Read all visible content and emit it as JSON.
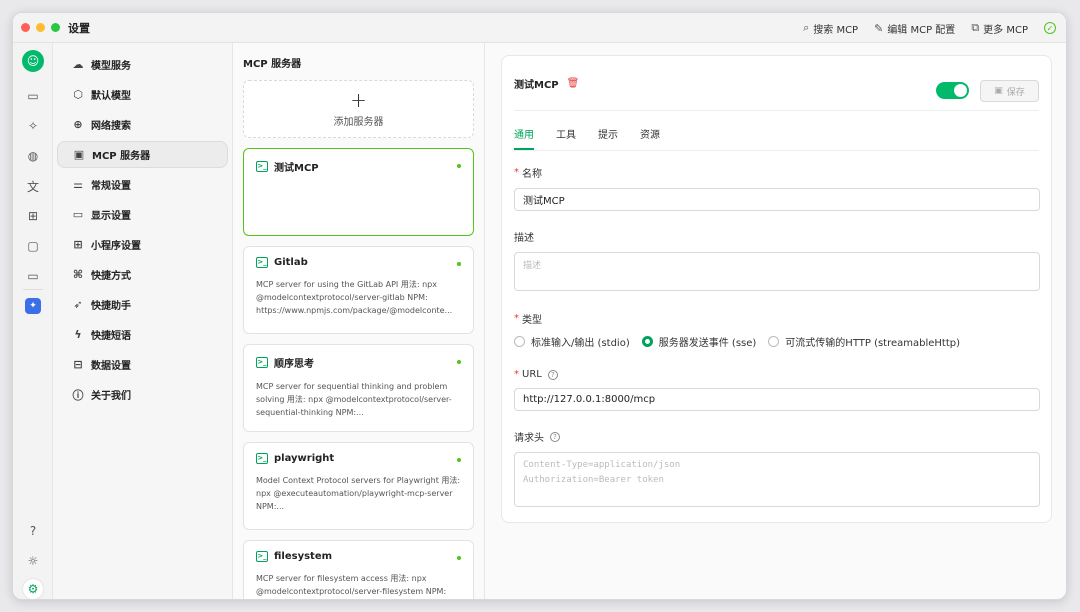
{
  "window": {
    "title": "设置"
  },
  "toolbar": {
    "search_mcp": "搜索 MCP",
    "edit_mcp_config": "编辑 MCP 配置",
    "more_mcp": "更多 MCP"
  },
  "settings_nav": [
    {
      "label": "模型服务",
      "icon": "cloud-icon"
    },
    {
      "label": "默认模型",
      "icon": "cube-icon"
    },
    {
      "label": "网络搜索",
      "icon": "globe-icon"
    },
    {
      "label": "MCP 服务器",
      "icon": "terminal-icon"
    },
    {
      "label": "常规设置",
      "icon": "sliders-icon"
    },
    {
      "label": "显示设置",
      "icon": "monitor-icon"
    },
    {
      "label": "小程序设置",
      "icon": "grid-icon"
    },
    {
      "label": "快捷方式",
      "icon": "command-icon"
    },
    {
      "label": "快捷助手",
      "icon": "rocket-icon"
    },
    {
      "label": "快捷短语",
      "icon": "zap-icon"
    },
    {
      "label": "数据设置",
      "icon": "hard-drive-icon"
    },
    {
      "label": "关于我们",
      "icon": "info-icon"
    }
  ],
  "server_list": {
    "title": "MCP 服务器",
    "add_label": "添加服务器",
    "servers": [
      {
        "name": "测试MCP",
        "desc": ""
      },
      {
        "name": "Gitlab",
        "desc": "MCP server for using the GitLab API 用法: npx @modelcontextprotocol/server-gitlab NPM: https://www.npmjs.com/package/@modelconte..."
      },
      {
        "name": "顺序思考",
        "desc": "MCP server for sequential thinking and problem solving 用法: npx @modelcontextprotocol/server-sequential-thinking NPM:..."
      },
      {
        "name": "playwright",
        "desc": "Model Context Protocol servers for Playwright 用法: npx @executeautomation/playwright-mcp-server NPM:..."
      },
      {
        "name": "filesystem",
        "desc": "MCP server for filesystem access 用法: npx @modelcontextprotocol/server-filesystem NPM: https://www.npmjs.com/package/@modelconte..."
      }
    ]
  },
  "detail": {
    "title": "测试MCP",
    "enabled": true,
    "save_label": "保存",
    "tabs": [
      "通用",
      "工具",
      "提示",
      "资源"
    ],
    "name_label": "名称",
    "name_value": "测试MCP",
    "desc_label": "描述",
    "desc_placeholder": "描述",
    "type_label": "类型",
    "type_options": [
      "标准输入/输出 (stdio)",
      "服务器发送事件 (sse)",
      "可流式传输的HTTP (streamableHttp)"
    ],
    "type_selected": 1,
    "url_label": "URL",
    "url_value": "http://127.0.0.1:8000/mcp",
    "headers_label": "请求头",
    "headers_placeholder_1": "Content-Type=application/json",
    "headers_placeholder_2": "Authorization=Bearer token"
  },
  "colors": {
    "accent": "#00a35c",
    "danger": "#e53935"
  }
}
